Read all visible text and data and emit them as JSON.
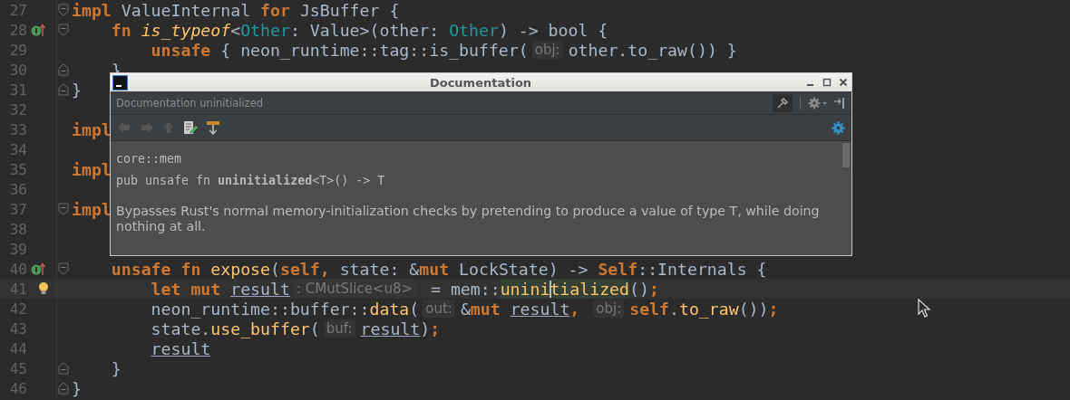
{
  "editor": {
    "lines": [
      {
        "number": "27",
        "fold_start": true,
        "tokens": [
          {
            "text": "impl ",
            "kind": "kw"
          },
          {
            "text": "ValueInternal ",
            "kind": "plain"
          },
          {
            "text": "for ",
            "kind": "kw"
          },
          {
            "text": "JsBuffer {",
            "kind": "plain"
          }
        ],
        "children": [
          {
            "number": "28",
            "fold_start": true,
            "implements_marker": true,
            "tokens": [
              {
                "text": "fn ",
                "kind": "kw"
              },
              {
                "text": "is_typeof",
                "kind": "fn_italic"
              },
              {
                "text": "<",
                "kind": "plain"
              },
              {
                "text": "Other",
                "kind": "type"
              },
              {
                "text": ": Value>(other: ",
                "kind": "plain"
              },
              {
                "text": "Other",
                "kind": "type"
              },
              {
                "text": ") -> bool {",
                "kind": "plain"
              }
            ],
            "children": [
              {
                "number": "29",
                "tokens": [
                  {
                    "text": "unsafe ",
                    "kind": "kw"
                  },
                  {
                    "text": "{ neon_runtime::tag::is_buffer(",
                    "kind": "plain"
                  },
                  {
                    "text": "obj:",
                    "kind": "hint"
                  },
                  {
                    "text": "other.to_raw()) }",
                    "kind": "plain"
                  }
                ]
              }
            ]
          },
          {
            "number": "30",
            "fold_end": true,
            "tokens": [
              {
                "text": "}",
                "kind": "plain"
              }
            ]
          }
        ]
      },
      {
        "number": "31",
        "fold_end": true,
        "tokens": [
          {
            "text": "}",
            "kind": "plain"
          }
        ]
      },
      {
        "number": "32"
      },
      {
        "number": "33",
        "tokens": [
          {
            "text": "impl",
            "kind": "kw"
          }
        ]
      },
      {
        "number": "34"
      },
      {
        "number": "35",
        "tokens": [
          {
            "text": "impl",
            "kind": "kw"
          }
        ]
      },
      {
        "number": "36"
      },
      {
        "number": "37",
        "fold_start": true,
        "tokens": [
          {
            "text": "impl",
            "kind": "kw"
          }
        ],
        "children": [
          {
            "number": "38"
          },
          {
            "number": "39"
          },
          {
            "number": "40",
            "fold_start": true,
            "implements_marker": true,
            "tokens": [
              {
                "text": "unsafe fn ",
                "kind": "kw"
              },
              {
                "text": "expose",
                "kind": "fn"
              },
              {
                "text": "(",
                "kind": "plain"
              },
              {
                "text": "self",
                "kind": "kw"
              },
              {
                "text": ", ",
                "kind": "kw"
              },
              {
                "text": "state: &",
                "kind": "plain"
              },
              {
                "text": "mut ",
                "kind": "kw"
              },
              {
                "text": "LockState) -> ",
                "kind": "plain"
              },
              {
                "text": "Self",
                "kind": "kw"
              },
              {
                "text": "::Internals {",
                "kind": "plain"
              }
            ],
            "children": [
              {
                "number": "41",
                "current": true,
                "bulb": true,
                "tokens": [
                  {
                    "text": "let mut ",
                    "kind": "kw"
                  },
                  {
                    "text": "result",
                    "kind": "ref"
                  },
                  {
                    "text": ": CMutSlice<u8>",
                    "kind": "hint"
                  },
                  {
                    "text": " = mem::",
                    "kind": "plain"
                  },
                  {
                    "text": "uninitialized",
                    "kind": "fn_caret"
                  },
                  {
                    "text": "()",
                    "kind": "plain"
                  },
                  {
                    "text": ";",
                    "kind": "kw"
                  }
                ]
              },
              {
                "number": "42",
                "tokens": [
                  {
                    "text": "neon_runtime::buffer::",
                    "kind": "plain"
                  },
                  {
                    "text": "data",
                    "kind": "fn"
                  },
                  {
                    "text": "(",
                    "kind": "plain"
                  },
                  {
                    "text": "out:",
                    "kind": "hint"
                  },
                  {
                    "text": "&",
                    "kind": "plain"
                  },
                  {
                    "text": "mut ",
                    "kind": "kw"
                  },
                  {
                    "text": "result",
                    "kind": "ref"
                  },
                  {
                    "text": ", ",
                    "kind": "kw"
                  },
                  {
                    "text": "obj:",
                    "kind": "hint"
                  },
                  {
                    "text": "self",
                    "kind": "kw"
                  },
                  {
                    "text": ".",
                    "kind": "plain"
                  },
                  {
                    "text": "to_raw",
                    "kind": "fn"
                  },
                  {
                    "text": "())",
                    "kind": "plain"
                  },
                  {
                    "text": ";",
                    "kind": "kw"
                  }
                ]
              },
              {
                "number": "43",
                "tokens": [
                  {
                    "text": "state.",
                    "kind": "plain"
                  },
                  {
                    "text": "use_buffer",
                    "kind": "fn"
                  },
                  {
                    "text": "(",
                    "kind": "plain"
                  },
                  {
                    "text": "buf:",
                    "kind": "hint"
                  },
                  {
                    "text": "result",
                    "kind": "ref"
                  },
                  {
                    "text": ")",
                    "kind": "plain"
                  },
                  {
                    "text": ";",
                    "kind": "kw"
                  }
                ]
              },
              {
                "number": "44",
                "tokens": [
                  {
                    "text": "result",
                    "kind": "ref"
                  }
                ]
              }
            ]
          },
          {
            "number": "45",
            "fold_end": true,
            "tokens": [
              {
                "text": "}",
                "kind": "plain"
              }
            ]
          }
        ]
      },
      {
        "number": "46",
        "fold_end": true,
        "tokens": [
          {
            "text": "}",
            "kind": "plain"
          }
        ]
      }
    ]
  },
  "doc_popup": {
    "window_title": "Documentation",
    "header": "Documentation uninitialized",
    "module": "core::mem",
    "signature": "pub unsafe fn **uninitialized**<T>() -> T",
    "description": "Bypasses Rust's normal memory-initialization checks by pretending to produce a value of type T, while doing nothing at all."
  }
}
